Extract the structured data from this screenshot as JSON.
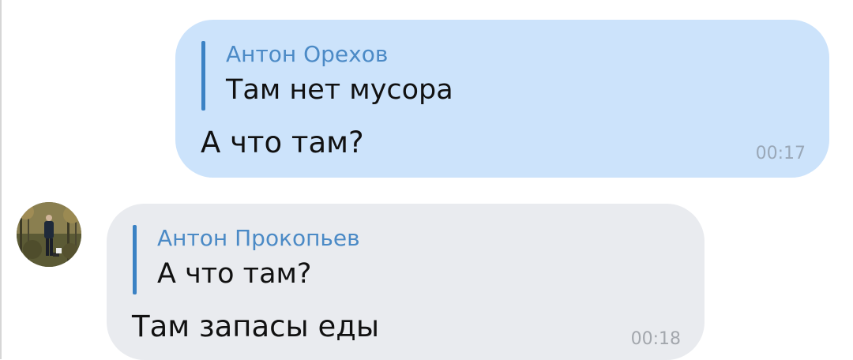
{
  "messages": [
    {
      "direction": "outgoing",
      "reply_to": {
        "author": "Антон Орехов",
        "text": "Там нет мусора"
      },
      "text": "А что там?",
      "time": "00:17"
    },
    {
      "direction": "incoming",
      "avatar": "user-photo-avatar",
      "reply_to": {
        "author": "Антон Прокопьев",
        "text": "А что там?"
      },
      "text": "Там запасы еды",
      "time": "00:18"
    }
  ],
  "colors": {
    "outgoing_bubble": "#cce3fb",
    "incoming_bubble": "#e9ebef",
    "quote_bar": "#3b82c4",
    "quote_author": "#4b8ac6"
  }
}
